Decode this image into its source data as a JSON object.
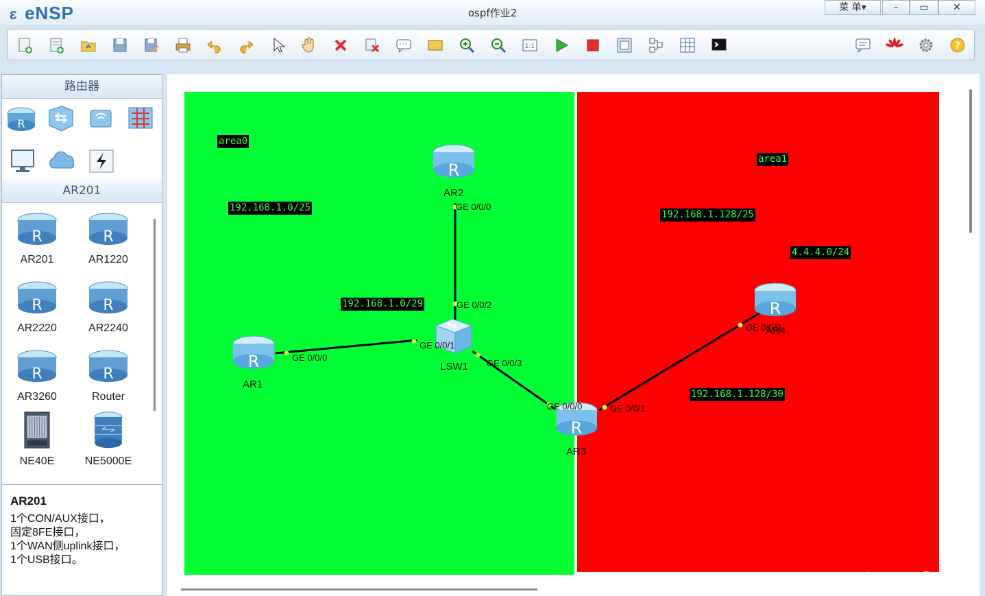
{
  "app": {
    "name": "eNSP",
    "window_title": "ospf作业2",
    "menu_label": "菜 单▾"
  },
  "window_controls": {
    "minimize": "–",
    "maximize": "▭",
    "close": "✕"
  },
  "toolbar": {
    "left_icons": [
      "new-topology-icon",
      "new-example-icon",
      "open-icon",
      "save-icon",
      "save-as-icon",
      "print-icon",
      "undo-icon",
      "redo-icon",
      "select-icon",
      "pan-hand-icon",
      "delete-icon",
      "delete-link-icon",
      "add-text-icon",
      "add-shape-icon",
      "zoom-in-icon",
      "zoom-out-icon",
      "fit-view-icon",
      "start-device-icon",
      "stop-device-icon",
      "capture-icon",
      "topology-icon",
      "grid-icon",
      "console-icon"
    ],
    "right_icons": [
      "chat-icon",
      "huawei-logo-icon",
      "settings-gear-icon",
      "help-icon"
    ]
  },
  "sidebar": {
    "category_title": "路由器",
    "categories": [
      "router-category-icon",
      "switch-category-icon",
      "wlan-category-icon",
      "firewall-category-icon",
      "pc-category-icon",
      "cloud-category-icon",
      "other-devices-icon"
    ],
    "subsection_title": "AR201",
    "devices": [
      {
        "label": "AR201"
      },
      {
        "label": "AR1220"
      },
      {
        "label": "AR2220"
      },
      {
        "label": "AR2240"
      },
      {
        "label": "AR3260"
      },
      {
        "label": "Router"
      },
      {
        "label": "NE40E"
      },
      {
        "label": "NE5000E"
      }
    ]
  },
  "info": {
    "title": "AR201",
    "lines": [
      "1个CON/AUX接口，",
      "固定8FE接口，",
      "1个WAN侧uplink接口，",
      "1个USB接口。"
    ]
  },
  "topology": {
    "areas": [
      {
        "name": "area0",
        "color": "#00ff33"
      },
      {
        "name": "area1",
        "color": "#ff0000"
      }
    ],
    "labels": [
      "area0",
      "area1",
      "192.168.1.0/25",
      "192.168.1.128/25",
      "4.4.4.0/24",
      "192.168.1.0/29",
      "192.168.1.128/30"
    ],
    "nodes": [
      {
        "name": "AR1"
      },
      {
        "name": "AR2"
      },
      {
        "name": "AR3"
      },
      {
        "name": "AR4"
      },
      {
        "name": "LSW1"
      }
    ],
    "ports": {
      "ar1_g000": "GE 0/0/0",
      "ar2_g000": "GE 0/0/0",
      "lsw1_g002": "GE 0/0/2",
      "lsw1_g001": "GE 0/0/1",
      "lsw1_g003": "GE 0/0/3",
      "ar3_g000": "GE 0/0/0",
      "ar3_g001": "GE 0/0/1",
      "ar4_g000": "GE 0/0/0"
    }
  },
  "watermark": "CSDN @sshik"
}
